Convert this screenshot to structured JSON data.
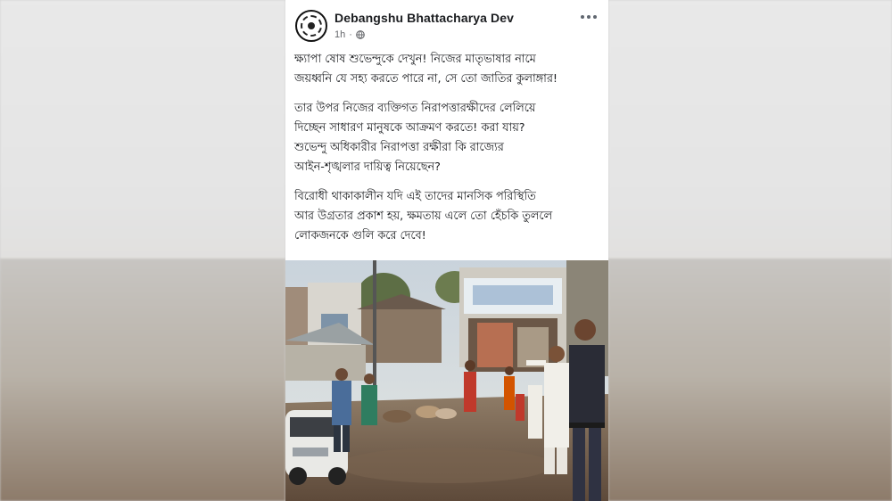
{
  "post": {
    "author": "Debangshu Bhattacharya Dev",
    "time": "1h",
    "privacy_icon": "globe-icon",
    "more_icon": "more-options-icon",
    "paragraphs": [
      "ক্ষ্যাপা ষোষ শুভেন্দুকে দেখুন! নিজের মাতৃভাষার নামে\nজয়ধ্বনি যে সহ্য করতে পারে না, সে তো জাতির কুলাঙ্গার!",
      "তার উপর নিজের ব্যক্তিগত নিরাপত্তারক্ষীদের লেলিয়ে\nদিচ্ছেন সাধারণ মানুষকে আক্রমণ করতে! করা যায়?\nশুভেন্দু অধিকারীর নিরাপত্তা রক্ষীরা কি রাজ্যের\nআইন-শৃঙ্খলার দায়িত্ব নিয়েছেন?",
      "বিরোধী থাকাকালীন যদি এই তাদের মানসিক পরিস্থিতি\nআর উগ্রতার প্রকাশ হয়, ক্ষমতায় এলে তো হেঁচকি তুললে\nলোকজনকে গুলি করে দেবে!"
    ]
  },
  "colors": {
    "author": "#1c1e21",
    "meta": "#65676b",
    "background": "#ffffff"
  }
}
